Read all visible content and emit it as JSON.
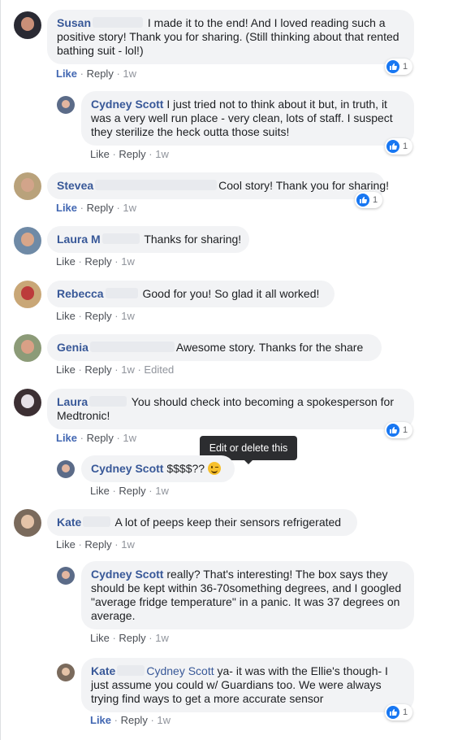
{
  "ui": {
    "like": "Like",
    "reply": "Reply",
    "sep": " · ",
    "tooltip": "Edit or delete this"
  },
  "comments": [
    {
      "name": "Susan",
      "text": " I made it to the end! And I loved reading such a positive story! Thank you for sharing. (Still thinking about that rented bathing suit - lol!)",
      "time": "1w",
      "reaction_count": "1"
    },
    {
      "name": "Cydney Scott",
      "text": " I just tried not to think about it but, in truth, it was a very well run place - very clean, lots of staff. I suspect they sterilize the heck outta those suits!",
      "time": "1w",
      "reaction_count": "1"
    },
    {
      "name": "Stevea",
      "text": "Cool story! Thank you for sharing!",
      "time": "1w",
      "reaction_count": "1"
    },
    {
      "name": "Laura M",
      "text": " Thanks for sharing!",
      "time": "1w"
    },
    {
      "name": "Rebecca",
      "text": " Good for you! So glad it all worked!",
      "time": "1w"
    },
    {
      "name": "Genia",
      "text": "Awesome story. Thanks for the share",
      "time": "1w",
      "edited": "Edited"
    },
    {
      "name": "Laura",
      "text": " You should check into becoming a spokesperson for Medtronic!",
      "time": "1w",
      "reaction_count": "1"
    },
    {
      "name": "Cydney Scott",
      "text": " $$$$?? ",
      "time": "1w"
    },
    {
      "name": "Kate",
      "text": " A lot of peeps keep their sensors refrigerated",
      "time": "1w"
    },
    {
      "name": "Cydney Scott",
      "text": " really? That's interesting! The box says they should be kept within 36-70something degrees, and I googled \"average fridge temperature\" in a panic. It was 37 degrees on average.",
      "time": "1w"
    },
    {
      "name": "Kate",
      "mention": "Cydney Scott",
      "text": " ya- it was with the Ellie's though- I just assume you could w/ Guardians too. We were always trying find ways to get a more accurate sensor",
      "time": "1w",
      "reaction_count": "1"
    }
  ]
}
